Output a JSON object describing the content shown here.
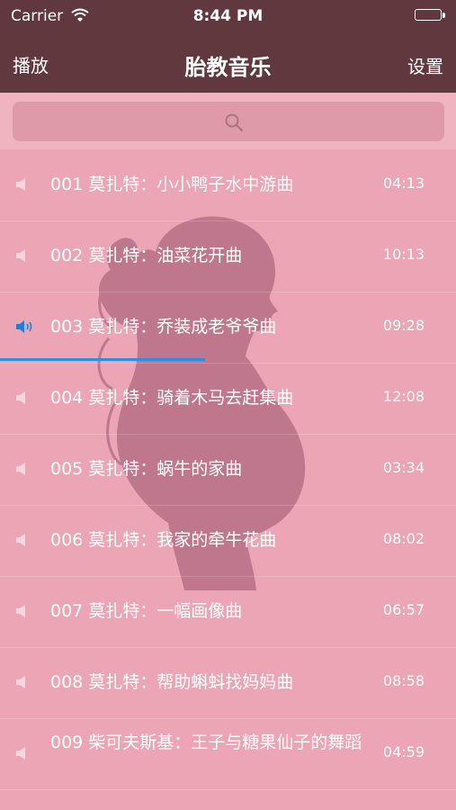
{
  "status": {
    "carrier": "Carrier",
    "time": "8:44 PM"
  },
  "nav": {
    "left": "播放",
    "title": "胎教音乐",
    "right": "设置"
  },
  "search": {
    "placeholder": ""
  },
  "colors": {
    "nav_bg": "#62383f",
    "list_bg": "#eba5b5",
    "progress": "#2d8ee6"
  },
  "playback": {
    "current_index": 3,
    "progress_fraction": 0.45
  },
  "tracks": [
    {
      "title": "001 莫扎特：小小鸭子水中游曲",
      "duration": "04:13",
      "playing": false
    },
    {
      "title": "002 莫扎特：油菜花开曲",
      "duration": "10:13",
      "playing": false
    },
    {
      "title": "003 莫扎特：乔装成老爷爷曲",
      "duration": "09:28",
      "playing": true
    },
    {
      "title": "004 莫扎特：骑着木马去赶集曲",
      "duration": "12:08",
      "playing": false
    },
    {
      "title": "005 莫扎特：蜗牛的家曲",
      "duration": "03:34",
      "playing": false
    },
    {
      "title": "006 莫扎特：我家的牵牛花曲",
      "duration": "08:02",
      "playing": false
    },
    {
      "title": "007 莫扎特：一幅画像曲",
      "duration": "06:57",
      "playing": false
    },
    {
      "title": "008 莫扎特：帮助蝌蚪找妈妈曲",
      "duration": "08:58",
      "playing": false
    },
    {
      "title": "009 柴可夫斯基：王子与糖果仙子的舞蹈",
      "duration": "04:59",
      "playing": false
    }
  ]
}
